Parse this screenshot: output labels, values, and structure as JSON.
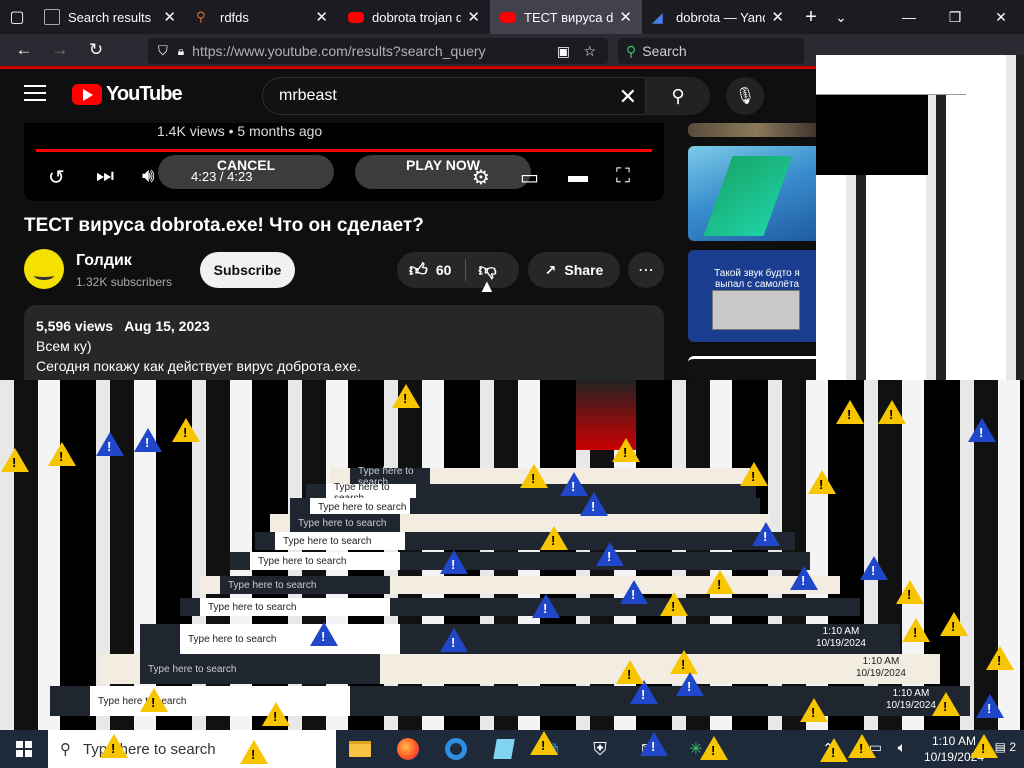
{
  "browser": {
    "tabs": [
      {
        "title": "Search results",
        "icon": "browser-tab-icon",
        "active": false
      },
      {
        "title": "rdfds",
        "icon": "search-icon",
        "active": false
      },
      {
        "title": "dobrota trojan do",
        "icon": "youtube-icon",
        "active": false
      },
      {
        "title": "ТЕСТ вируса dobro",
        "icon": "youtube-icon",
        "active": true
      },
      {
        "title": "dobrota — Yandex",
        "icon": "yandex-icon",
        "active": false
      }
    ],
    "new_tab": "+",
    "url": "https://www.youtube.com/results?search_query",
    "search_placeholder": "Search"
  },
  "youtube": {
    "logo_text": "YouTube",
    "search_query": "mrbeast",
    "player": {
      "meta": "1.4K views • 5 months ago",
      "time": "4:23 / 4:23",
      "cancel_label": "CANCEL",
      "play_now_label": "PLAY NOW",
      "progress": 1.0
    },
    "video_title": "ТЕСТ вируса dobrota.exe! Что он сделает?",
    "channel": {
      "name": "Голдик",
      "subscribers": "1.32K subscribers",
      "subscribe_label": "Subscribe"
    },
    "likes": "60",
    "share_label": "Share",
    "description": {
      "views": "5,596 views",
      "date": "Aug 15, 2023",
      "line1": "Всем ку)",
      "line2": "Сегодня покажу как действует вирус доброта.exe."
    },
    "recommended": [
      {
        "caption": ""
      },
      {
        "caption": ""
      },
      {
        "caption": "Такой звук будто я выпал с самолёта"
      },
      {
        "caption": ""
      }
    ]
  },
  "glitch": {
    "search_text": "Type here to search",
    "clock_time": "1:10 AM",
    "clock_date": "10/19/2024"
  },
  "taskbar": {
    "search_text": "Type here to search",
    "time": "1:10 AM",
    "date": "10/19/2024",
    "notification_count": "2"
  },
  "colors": {
    "youtube_red": "#ff0000",
    "warning_yellow": "#f7c600",
    "warning_blue": "#2047c9"
  }
}
